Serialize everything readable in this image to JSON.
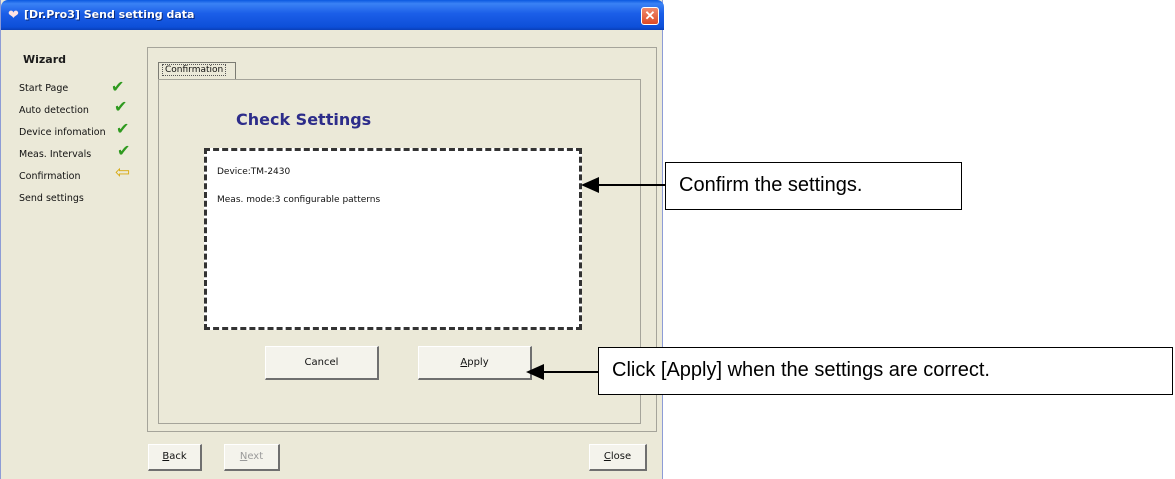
{
  "window": {
    "title": "[Dr.Pro3] Send setting data",
    "close_label": "✕"
  },
  "wizard": {
    "title": "Wizard",
    "steps": [
      {
        "label": "Start Page",
        "status_icon": "checkmark-icon"
      },
      {
        "label": "Auto detection",
        "status_icon": "checkmark-icon"
      },
      {
        "label": "Device infomation",
        "status_icon": "checkmark-icon"
      },
      {
        "label": "Meas. Intervals",
        "status_icon": "checkmark-icon"
      },
      {
        "label": "Confirmation",
        "status_icon": "arrow-left-icon"
      },
      {
        "label": "Send settings",
        "status_icon": ""
      }
    ]
  },
  "main": {
    "tab_label": "Confirmation",
    "heading": "Check Settings",
    "settings_lines": [
      "Device:TM-2430",
      "Meas. mode:3 configurable patterns"
    ],
    "buttons": {
      "cancel": "Cancel",
      "apply_first": "A",
      "apply_rest": "pply"
    }
  },
  "footer": {
    "back_first": "B",
    "back_rest": "ack",
    "next_first": "N",
    "next_rest": "ext",
    "close_first": "C",
    "close_rest": "lose"
  },
  "callouts": {
    "confirm": "Confirm the settings.",
    "apply": "Click [Apply] when the settings are correct."
  },
  "colors": {
    "titlebar": "#0d4fd8",
    "window_bg": "#ebe9d8",
    "heading": "#2d2d8a",
    "check_green": "#2f9a1f",
    "arrow_yellow": "#d8aa10"
  }
}
